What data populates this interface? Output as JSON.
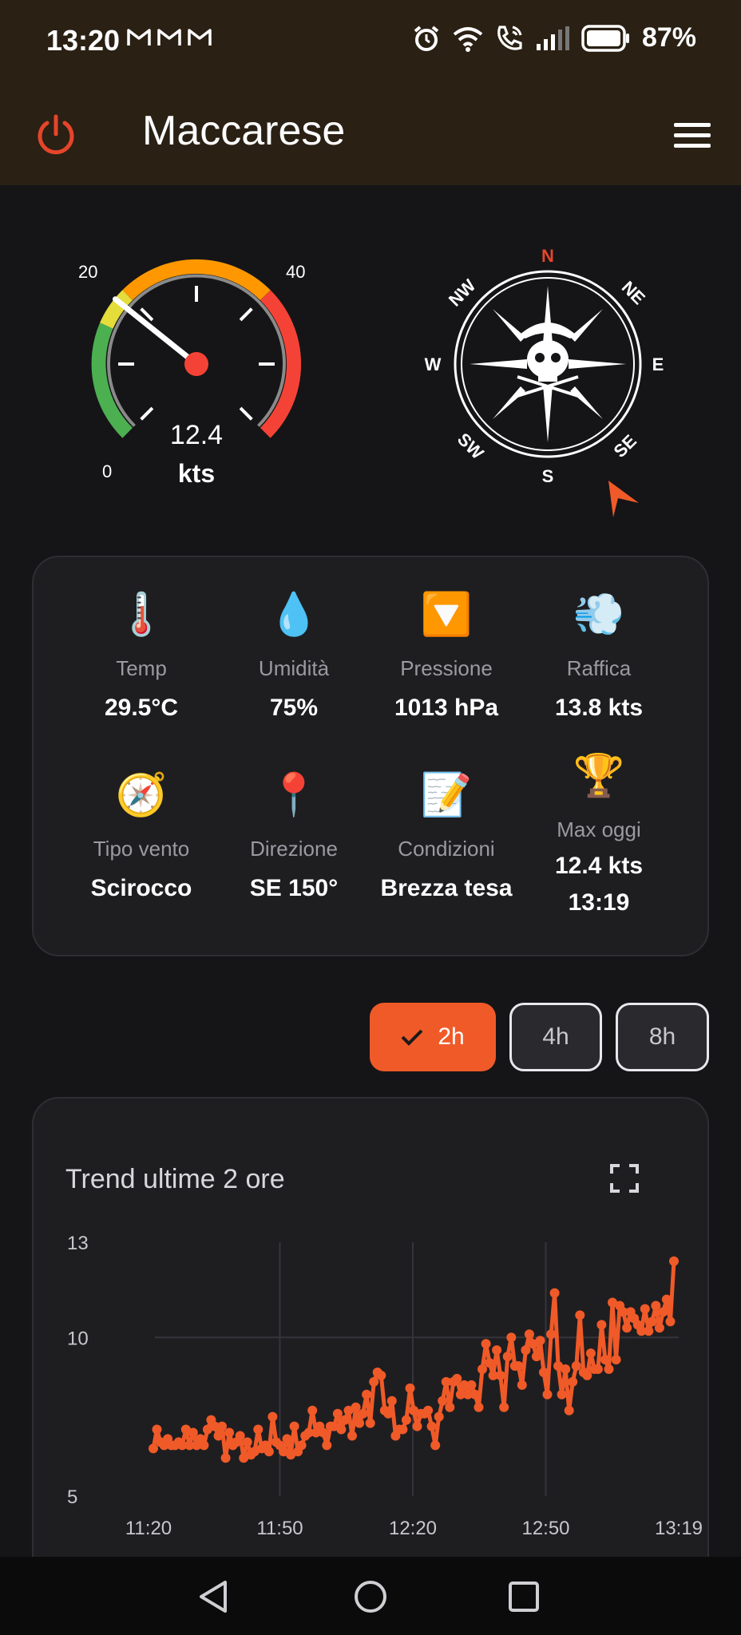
{
  "status": {
    "time": "13:20",
    "battery": "87%",
    "icons": [
      "gmail-icon",
      "gmail-icon",
      "gmail-icon",
      "alarm-icon",
      "wifi-icon",
      "wifi-call-icon",
      "signal-icon",
      "battery-icon"
    ]
  },
  "app": {
    "title": "Maccarese",
    "accent": "#f05a28"
  },
  "gauge": {
    "value": 12.4,
    "value_text": "12.4",
    "unit": "kts",
    "ticks": [
      "0",
      "20",
      "40"
    ],
    "min": 0,
    "max": 40
  },
  "compass": {
    "labels": {
      "n": "N",
      "ne": "NE",
      "e": "E",
      "se": "SE",
      "s": "S",
      "sw": "SW",
      "w": "W",
      "nw": "NW"
    },
    "direction_deg": 150
  },
  "stats": [
    {
      "icon": "🌡️",
      "icon_name": "thermometer-icon",
      "label": "Temp",
      "value": "29.5°C"
    },
    {
      "icon": "💧",
      "icon_name": "droplet-icon",
      "label": "Umidità",
      "value": "75%"
    },
    {
      "icon": "🔽",
      "icon_name": "pressure-down-icon",
      "label": "Pressione",
      "value": "1013 hPa"
    },
    {
      "icon": "💨",
      "icon_name": "gust-icon",
      "label": "Raffica",
      "value": "13.8 kts"
    },
    {
      "icon": "🧭",
      "icon_name": "compass-icon",
      "label": "Tipo vento",
      "value": "Scirocco"
    },
    {
      "icon": "📍",
      "icon_name": "pin-icon",
      "label": "Direzione",
      "value": "SE 150°"
    },
    {
      "icon": "📝",
      "icon_name": "memo-icon",
      "label": "Condizioni",
      "value": "Brezza tesa"
    },
    {
      "icon": "🏆",
      "icon_name": "trophy-icon",
      "label": "Max oggi",
      "value": "12.4 kts",
      "value2": "13:19"
    }
  ],
  "range": {
    "options": [
      "2h",
      "4h",
      "8h"
    ],
    "selected": "2h"
  },
  "trend": {
    "title": "Trend ultime  2 ore"
  },
  "chart_data": {
    "type": "line",
    "title": "Trend ultime  2 ore",
    "xlabel": "",
    "ylabel": "",
    "ylim": [
      5,
      13
    ],
    "yticks": [
      "13",
      "10",
      "5"
    ],
    "xticks": [
      "11:20",
      "11:50",
      "12:20",
      "12:50",
      "13:19"
    ],
    "grid": true,
    "series": [
      {
        "color": "#f05a28",
        "values": [
          6.5,
          7.1,
          6.7,
          6.6,
          6.8,
          6.6,
          6.6,
          6.7,
          6.6,
          7.1,
          6.6,
          7.0,
          6.6,
          6.8,
          6.6,
          7.1,
          7.4,
          7.2,
          6.9,
          7.2,
          6.2,
          7.0,
          6.6,
          6.7,
          6.9,
          6.2,
          6.7,
          6.3,
          6.4,
          7.1,
          6.5,
          6.6,
          6.4,
          7.5,
          6.7,
          6.6,
          6.4,
          6.8,
          6.3,
          7.2,
          6.4,
          6.6,
          6.9,
          7.0,
          7.7,
          7.0,
          7.2,
          7.0,
          6.6,
          7.2,
          7.2,
          7.6,
          7.1,
          7.4,
          7.7,
          6.9,
          7.8,
          7.3,
          7.6,
          8.2,
          7.3,
          8.6,
          8.9,
          8.8,
          7.7,
          7.6,
          8.0,
          6.9,
          7.1,
          7.1,
          7.4,
          8.4,
          7.7,
          7.2,
          7.6,
          7.6,
          7.7,
          7.2,
          6.6,
          7.5,
          8.0,
          8.6,
          7.8,
          8.6,
          8.7,
          8.2,
          8.5,
          8.2,
          8.5,
          8.2,
          7.8,
          9.0,
          9.8,
          9.2,
          8.8,
          9.6,
          8.8,
          7.8,
          9.4,
          10.0,
          9.1,
          9.1,
          8.5,
          9.6,
          10.1,
          9.8,
          9.4,
          9.9,
          8.9,
          8.2,
          10.1,
          11.4,
          9.1,
          8.2,
          9.0,
          7.7,
          8.6,
          9.1,
          10.7,
          8.9,
          8.8,
          9.5,
          9.0,
          9.0,
          10.4,
          9.3,
          9.0,
          11.1,
          9.3,
          11.0,
          10.8,
          10.3,
          10.8,
          10.6,
          10.4,
          10.2,
          10.9,
          10.2,
          10.5,
          11.0,
          10.3,
          10.8,
          11.2,
          10.5,
          12.4
        ]
      }
    ]
  }
}
